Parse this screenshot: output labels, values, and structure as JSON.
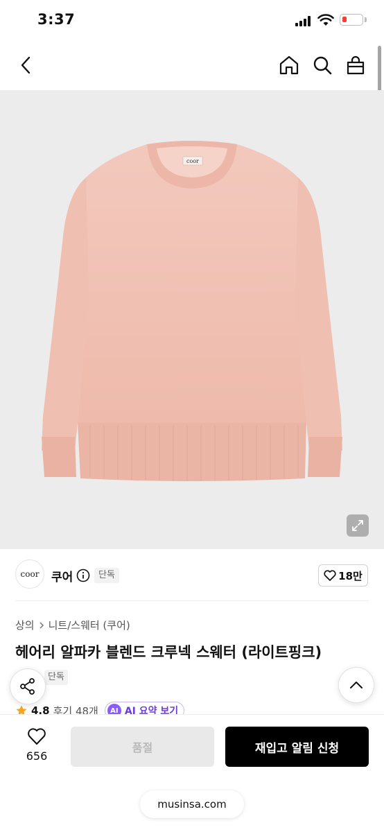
{
  "status_bar": {
    "time": "3:37",
    "battery_color": "#ff3b30"
  },
  "nav": {
    "back_icon": "chevron-left-icon",
    "home_icon": "home-icon",
    "search_icon": "search-icon",
    "cart_icon": "shopping-bag-icon"
  },
  "product_image": {
    "logo_text": "coor",
    "sweater_color": "#f1c3b6"
  },
  "brand": {
    "logo_text": "coor",
    "name": "쿠어",
    "badge": "단독",
    "like_count": "18만"
  },
  "breadcrumb": {
    "category": "상의",
    "subcategory": "니트/스웨터 (쿠어)"
  },
  "product": {
    "title": "헤어리 알파카 블렌드 크루넥 스웨터 (라이트핑크)",
    "tag": "단독",
    "rating": "4.8",
    "reviews": "후기 48개",
    "ai_badge": "AI",
    "ai_summary": "AI 요약 보기"
  },
  "bottom_bar": {
    "wish_count": "656",
    "soldout_label": "품절",
    "restock_label": "재입고 알림 신청"
  },
  "browser": {
    "url": "musinsa.com"
  },
  "colors": {
    "accent": "#000000",
    "star": "#f5a623",
    "ai": "#8b5cf6"
  }
}
